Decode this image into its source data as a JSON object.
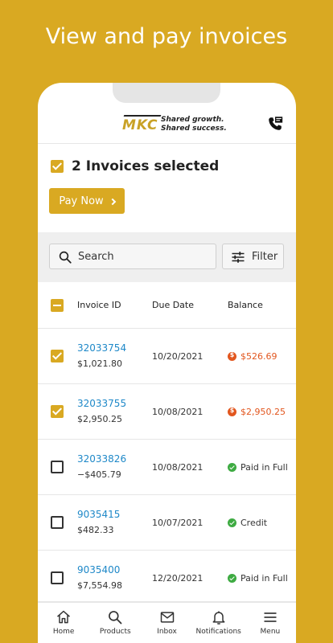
{
  "headline": "View and pay invoices",
  "header": {
    "logo_text": "MKC",
    "tagline_1": "Shared growth.",
    "tagline_2": "Shared success.",
    "contact_icon": "phone-contact-icon"
  },
  "selection": {
    "text": "2 Invoices selected",
    "pay_label": "Pay Now"
  },
  "toolbar": {
    "search_label": "Search",
    "filter_label": "Filter"
  },
  "table": {
    "columns": [
      "Invoice ID",
      "Due Date",
      "Balance"
    ],
    "rows": [
      {
        "id": "32033754",
        "amount": "$1,021.80",
        "due": "10/20/2021",
        "balance": "$526.69",
        "status": "owed",
        "checked": true
      },
      {
        "id": "32033755",
        "amount": "$2,950.25",
        "due": "10/08/2021",
        "balance": "$2,950.25",
        "status": "owed",
        "checked": true
      },
      {
        "id": "32033826",
        "amount": "−$405.79",
        "due": "10/08/2021",
        "balance": "Paid in Full",
        "status": "paid",
        "checked": false
      },
      {
        "id": "9035415",
        "amount": "$482.33",
        "due": "10/07/2021",
        "balance": "Credit",
        "status": "paid",
        "checked": false
      },
      {
        "id": "9035400",
        "amount": "$7,554.98",
        "due": "12/20/2021",
        "balance": "Paid in Full",
        "status": "paid",
        "checked": false
      }
    ]
  },
  "nav": {
    "items": [
      {
        "label": "Home",
        "icon": "home-icon"
      },
      {
        "label": "Products",
        "icon": "search-icon"
      },
      {
        "label": "Inbox",
        "icon": "mail-icon"
      },
      {
        "label": "Notifications",
        "icon": "bell-icon"
      },
      {
        "label": "Menu",
        "icon": "menu-icon"
      }
    ]
  },
  "colors": {
    "brand": "#d9a922",
    "link": "#1e88c8",
    "owed": "#e2561e",
    "paid": "#3eab42"
  }
}
